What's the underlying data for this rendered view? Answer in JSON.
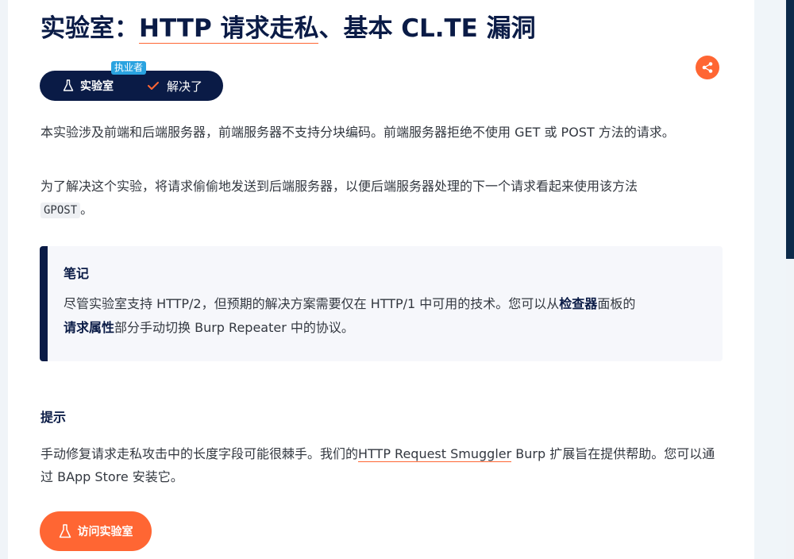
{
  "page": {
    "title_prefix": "实验室：",
    "title_highlight": "HTTP 请求走私",
    "title_suffix": "、基本 CL.TE 漏洞"
  },
  "status": {
    "level_badge": "执业者",
    "lab_label": "实验室",
    "solved_label": "解决了"
  },
  "description": {
    "p1": "本实验涉及前端和后端服务器，前端服务器不支持分块编码。前端服务器拒绝不使用 GET 或 POST 方法的请求。",
    "p2_text": "为了解决这个实验，将请求偷偷地发送到后端服务器，以便后端服务器处理的下一个请求看起来使用该方法",
    "p2_code": "GPOST",
    "p2_end": "。"
  },
  "note": {
    "title": "笔记",
    "body_before": "尽管实验室支持 HTTP/2，但预期的解决方案需要仅在 HTTP/1 中可用的技术。您可以从",
    "inspector": "检查器",
    "body_middle": "面板的",
    "request_attributes": "请求属性",
    "body_after": "部分手动切换 Burp Repeater 中的协议。"
  },
  "hint": {
    "title": "提示",
    "text_before": "手动修复请求走私攻击中的长度字段可能很棘手。我们的",
    "link_text": "HTTP Request Smuggler",
    "text_after": " Burp 扩展旨在提供帮助。您可以通过 BApp Store 安装它。"
  },
  "actions": {
    "access_lab": "访问实验室"
  },
  "icons": {
    "lab": "flask-icon",
    "solved": "check-icon",
    "share": "share-icon",
    "access": "flask-icon"
  },
  "colors": {
    "navy": "#0a1b46",
    "accent": "#ff6633",
    "badge_blue": "#2aa3e0"
  }
}
